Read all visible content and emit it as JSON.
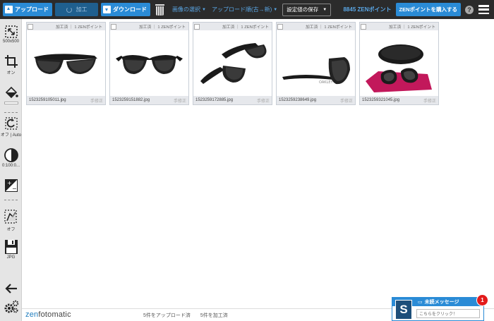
{
  "toolbar": {
    "upload_label": "アップロード",
    "process_label": "加工",
    "download_label": "ダウンロード",
    "select_images_label": "画像の選択",
    "sort_label": "アップロード順(古→新)",
    "save_settings_label": "設定値の保存",
    "points_label": "8845 ZENポイント",
    "buy_points_label": "ZENポイントを購入する",
    "help_label": "?"
  },
  "sidebar": {
    "size_label": "500x500",
    "crop_label": "オン",
    "rotate_label": "オフ | Auto",
    "levels_label": "0:100:0...",
    "shadow_label": "オフ",
    "format_label": "JPG"
  },
  "cards": [
    {
      "status": "加工済 ｜ 1 ZENポイント",
      "filename": "1523259105011.jpg",
      "fix_label": "手修正"
    },
    {
      "status": "加工済 ｜ 1 ZENポイント",
      "filename": "1523259151882.jpg",
      "fix_label": "手修正"
    },
    {
      "status": "加工済 ｜ 1 ZENポイント",
      "filename": "1523259172885.jpg",
      "fix_label": "手修正"
    },
    {
      "status": "加工済 ｜ 1 ZENポイント",
      "filename": "1523259238649.jpg",
      "fix_label": "手修正"
    },
    {
      "status": "加工済 ｜ 1 ZENポイント",
      "filename": "1523259321045.jpg",
      "fix_label": "手修正"
    }
  ],
  "footer": {
    "logo_prefix": "zen",
    "logo_suffix": "fotomatic",
    "uploaded_status": "5件をアップロード済",
    "processed_status": "5件を加工済"
  },
  "chat": {
    "title": "未読メッセージ",
    "placeholder": "こちらをクリック！",
    "badge_count": "1",
    "avatar_letter": "S"
  }
}
